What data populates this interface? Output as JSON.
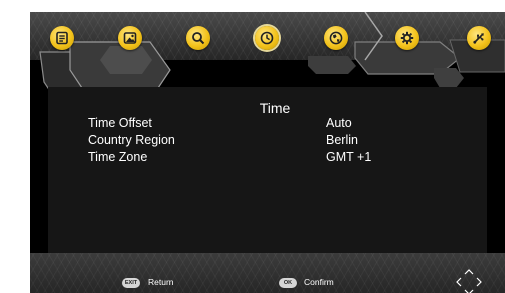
{
  "nav": {
    "items": [
      {
        "icon": "list-icon"
      },
      {
        "icon": "picture-icon"
      },
      {
        "icon": "search-icon"
      },
      {
        "icon": "clock-icon"
      },
      {
        "icon": "globe-icon"
      },
      {
        "icon": "gear-icon"
      },
      {
        "icon": "usb-icon"
      }
    ],
    "active_icon": "clock-icon",
    "accent_color": "#f3c21b"
  },
  "page": {
    "title": "Time"
  },
  "settings": [
    {
      "label": "Time Offset",
      "value": "Auto"
    },
    {
      "label": "Country Region",
      "value": "Berlin"
    },
    {
      "label": "Time Zone",
      "value": "GMT +1"
    }
  ],
  "footer": {
    "return_key": "EXIT",
    "return_label": "Return",
    "confirm_key": "OK",
    "confirm_label": "Confirm",
    "navigation_icon": "four-arrows-icon"
  }
}
